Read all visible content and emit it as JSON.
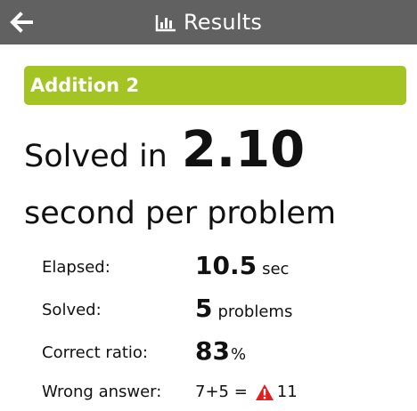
{
  "header": {
    "title": "Results",
    "back_icon": "arrow-left-icon",
    "title_icon": "bar-chart-icon"
  },
  "section": {
    "title": "Addition 2",
    "accent_color": "#a4c424"
  },
  "summary": {
    "lead": "Solved in",
    "rate": "2.10",
    "rate_unit": "second per problem"
  },
  "stats": {
    "elapsed": {
      "label": "Elapsed:",
      "value": "10.5",
      "unit": "sec"
    },
    "solved": {
      "label": "Solved:",
      "value": "5",
      "unit": "problems"
    },
    "correct_ratio": {
      "label": "Correct ratio:",
      "value": "83",
      "unit": "%"
    },
    "wrong_answer": {
      "label": "Wrong answer:",
      "problem": "7+5 =",
      "answer": "11",
      "warn_icon": "warning-icon",
      "warn_color": "#e02020"
    }
  }
}
